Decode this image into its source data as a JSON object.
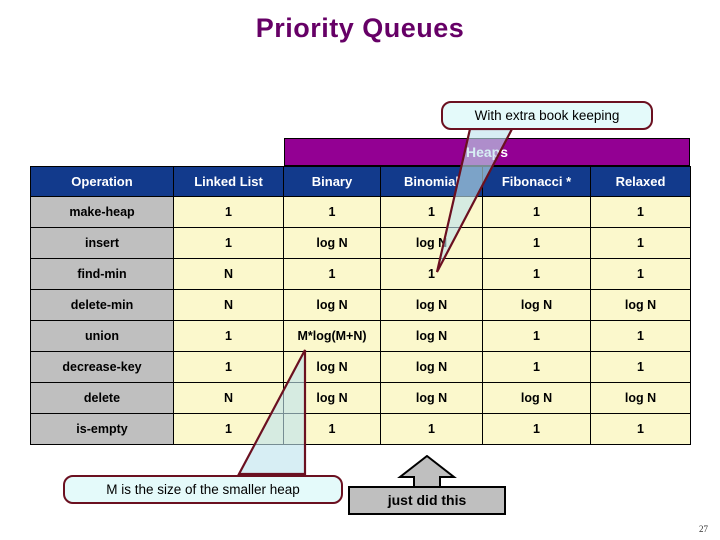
{
  "slide": {
    "title": "Priority Queues",
    "page_number": "27"
  },
  "table": {
    "group_header": "Heaps",
    "columns": [
      "Operation",
      "Linked List",
      "Binary",
      "Binomial",
      "Fibonacci *",
      "Relaxed"
    ],
    "rows": [
      {
        "operation": "make-heap",
        "values": [
          "1",
          "1",
          "1",
          "1",
          "1"
        ]
      },
      {
        "operation": "insert",
        "values": [
          "1",
          "log N",
          "log N",
          "1",
          "1"
        ]
      },
      {
        "operation": "find-min",
        "values": [
          "N",
          "1",
          "1",
          "1",
          "1"
        ]
      },
      {
        "operation": "delete-min",
        "values": [
          "N",
          "log N",
          "log N",
          "log N",
          "log N"
        ]
      },
      {
        "operation": "union",
        "values": [
          "1",
          "M*log(M+N)",
          "log N",
          "1",
          "1"
        ]
      },
      {
        "operation": "decrease-key",
        "values": [
          "1",
          "log N",
          "log N",
          "1",
          "1"
        ]
      },
      {
        "operation": "delete",
        "values": [
          "N",
          "log N",
          "log N",
          "log N",
          "log N"
        ]
      },
      {
        "operation": "is-empty",
        "values": [
          "1",
          "1",
          "1",
          "1",
          "1"
        ]
      }
    ]
  },
  "callouts": {
    "bookkeeping": "With extra book keeping",
    "smaller_heap": "M is the size of the smaller heap"
  },
  "annotation": {
    "just_did_this": "just did this",
    "arrow_icon": "up-arrow-icon"
  },
  "colors": {
    "title": "#660066",
    "header_blue": "#123A8C",
    "heaps_purple": "#930093",
    "operation_gray": "#BFBFBF",
    "value_yellow": "#FBF8CC",
    "callout_fill": "#E4FAFA",
    "callout_border": "#6B1020",
    "annotation_gray": "#BFBFBF"
  }
}
